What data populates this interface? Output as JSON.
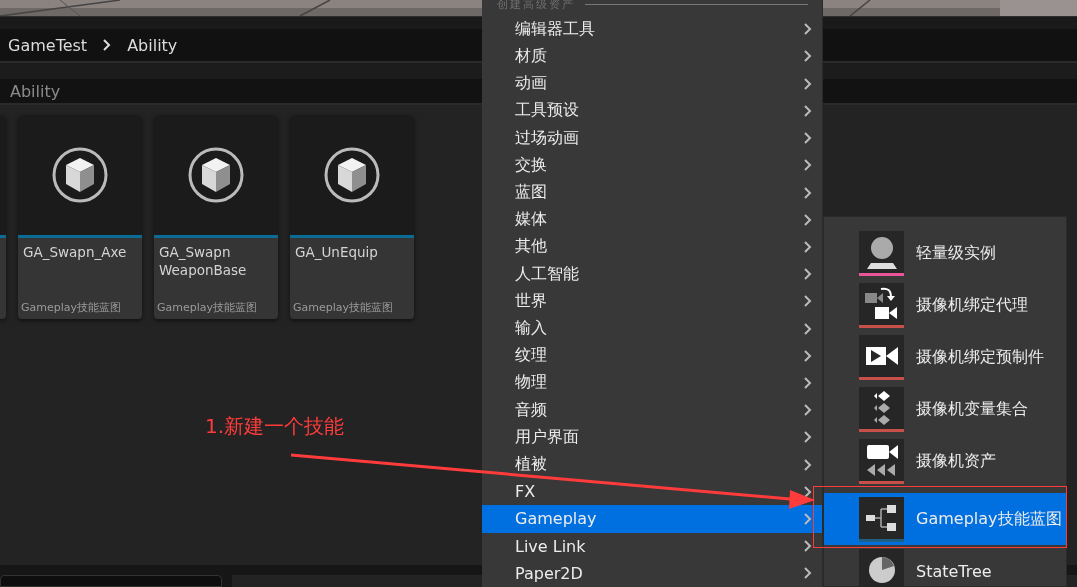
{
  "viewport": {
    "kind": "picture"
  },
  "breadcrumb": [
    "GameTest",
    "Ability"
  ],
  "search": {
    "value": "Ability"
  },
  "assets": [
    {
      "name": "GA_Swapn_Axe",
      "type": "Gameplay技能蓝图"
    },
    {
      "name": "GA_Swapn WeaponBase",
      "type": "Gameplay技能蓝图"
    },
    {
      "name": "GA_UnEquip",
      "type": "Gameplay技能蓝图"
    }
  ],
  "menu": {
    "header": "创建高级资产",
    "items": [
      {
        "label": "编辑器工具",
        "selected": false
      },
      {
        "label": "材质",
        "selected": false
      },
      {
        "label": "动画",
        "selected": false
      },
      {
        "label": "工具预设",
        "selected": false
      },
      {
        "label": "过场动画",
        "selected": false
      },
      {
        "label": "交换",
        "selected": false
      },
      {
        "label": "蓝图",
        "selected": false
      },
      {
        "label": "媒体",
        "selected": false
      },
      {
        "label": "其他",
        "selected": false
      },
      {
        "label": "人工智能",
        "selected": false
      },
      {
        "label": "世界",
        "selected": false
      },
      {
        "label": "输入",
        "selected": false
      },
      {
        "label": "纹理",
        "selected": false
      },
      {
        "label": "物理",
        "selected": false
      },
      {
        "label": "音频",
        "selected": false
      },
      {
        "label": "用户界面",
        "selected": false
      },
      {
        "label": "植被",
        "selected": false
      },
      {
        "label": "FX",
        "selected": false
      },
      {
        "label": "Gameplay",
        "selected": true
      },
      {
        "label": "Live Link",
        "selected": false
      },
      {
        "label": "Paper2D",
        "selected": false
      }
    ]
  },
  "submenu": {
    "items": [
      {
        "label": "轻量级实例",
        "kind": "sphere",
        "color": "#e8559a",
        "selected": false
      },
      {
        "label": "摄像机绑定代理",
        "kind": "camera-proxy",
        "color": "#c8504a",
        "selected": false
      },
      {
        "label": "摄像机绑定预制件",
        "kind": "camera-prefab",
        "color": "#c8504a",
        "selected": false
      },
      {
        "label": "摄像机变量集合",
        "kind": "camera-variables",
        "color": "#c8504a",
        "selected": false
      },
      {
        "label": "摄像机资产",
        "kind": "camera-asset",
        "color": "#c8504a",
        "selected": false
      },
      {
        "label": "Gameplay技能蓝图",
        "kind": "ability",
        "color": "#1f5f86",
        "selected": true
      },
      {
        "label": "StateTree",
        "kind": "statetree",
        "color": "#2b2b2b",
        "selected": false
      }
    ]
  },
  "annotation": {
    "text": "1.新建一个技能"
  }
}
